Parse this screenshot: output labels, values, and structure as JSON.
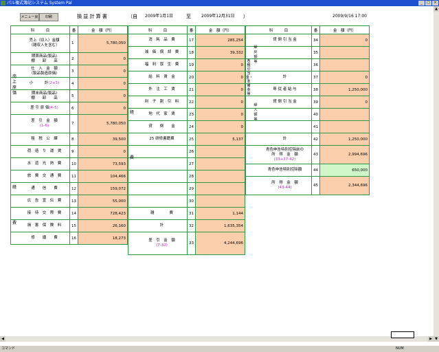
{
  "window": {
    "title": "パル複式簿記システム System Pal",
    "min": "_",
    "max": "□",
    "close": "×"
  },
  "toolbar": {
    "menu_back": "メニュー戻",
    "print": "印刷"
  },
  "header": {
    "report_title": "損 益 計 算 書",
    "from_label": "（自",
    "from_date": "2009年1月1日",
    "to_label": "至",
    "to_date": "2009年12月31日",
    "to_close": "）",
    "printed_at": "2009/9/16 17:00"
  },
  "col": {
    "item": "科　　　目",
    "no": "番",
    "amount": "金　額（円）"
  },
  "t1": {
    "rows": [
      {
        "no": "1",
        "label": "売上（収入）金額",
        "sub": "（雑収入を含む）",
        "amount": "5,780,050"
      },
      {
        "no": "2",
        "label": "期首商品(製品)",
        "sub": "棚　　卸　　高",
        "amount": "0"
      },
      {
        "no": "3",
        "label": "仕　入　金　額",
        "sub": "（製品製造原価）",
        "amount": "0"
      },
      {
        "no": "4",
        "label": "小　　　計",
        "pk": "(2+3)",
        "amount": "0"
      },
      {
        "no": "5",
        "label": "期末商品(製品)",
        "sub": "棚　　卸　　高",
        "amount": "0"
      },
      {
        "no": "6",
        "label": "差 引 原 価",
        "pk": "(4-5)",
        "amount": "0"
      },
      {
        "no": "7",
        "label": "差　引　金　額",
        "pksub": "(1-6)",
        "amount": "5,780,050"
      },
      {
        "no": "8",
        "label": "租　税　公　課",
        "amount": "39,500"
      },
      {
        "no": "9",
        "label": "荷　造　り　運　賃",
        "amount": "0"
      },
      {
        "no": "10",
        "label": "水　道　光　熱　費",
        "amount": "73,593"
      },
      {
        "no": "11",
        "label": "旅　費　交　通　費",
        "amount": "104,466"
      },
      {
        "no": "12",
        "label": "通　　信　　費",
        "amount": "159,072"
      },
      {
        "no": "13",
        "label": "広　告　宣　伝　費",
        "amount": "55,000"
      },
      {
        "no": "14",
        "label": "接　待　交　際　費",
        "amount": "728,423"
      },
      {
        "no": "15",
        "label": "損　害　保　険　料",
        "amount": "26,160"
      },
      {
        "no": "16",
        "label": "修　　繕　　費",
        "amount": "18,273"
      }
    ],
    "side_cost": "売上原価",
    "side_exp1": "経",
    "side_exp2": "費"
  },
  "t2": {
    "rows": [
      {
        "no": "17",
        "label": "消　耗　品　費",
        "amount": "285,254"
      },
      {
        "no": "18",
        "label": "減　価　償　却　費",
        "amount": "39,332"
      },
      {
        "no": "19",
        "label": "福　利　厚　生　費",
        "amount": "0"
      },
      {
        "no": "20",
        "label": "給　料　賃　金",
        "amount": "0"
      },
      {
        "no": "21",
        "label": "外　注　工　賃",
        "amount": "0"
      },
      {
        "no": "22",
        "label": "利　子　割　引　料",
        "amount": "0"
      },
      {
        "no": "23",
        "label": "地　代　家　賃",
        "amount": "0"
      },
      {
        "no": "24",
        "label": "貸　　倒　　金",
        "amount": "0"
      },
      {
        "no": "25",
        "label": "25 研修書籍費",
        "amount": "5,137"
      },
      {
        "no": "26",
        "label": "",
        "amount": ""
      },
      {
        "no": "27",
        "label": "",
        "amount": ""
      },
      {
        "no": "28",
        "label": "",
        "amount": ""
      },
      {
        "no": "29",
        "label": "",
        "amount": ""
      },
      {
        "no": "30",
        "label": "",
        "amount": ""
      },
      {
        "no": "31",
        "label": "雑　　　　費",
        "amount": "1,144"
      },
      {
        "no": "32",
        "label": "計",
        "amount": "1,635,354"
      },
      {
        "no": "33",
        "label": "差　引　金　額",
        "pksub": "(7-32)",
        "amount": "4,244,696"
      }
    ],
    "side_exp1": "経",
    "side_exp2": "費"
  },
  "t3": {
    "rows": [
      {
        "no": "34",
        "label": "貸 倒 引 当 金",
        "amount": "0"
      },
      {
        "no": "35",
        "label": "",
        "amount": ""
      },
      {
        "no": "36",
        "label": "",
        "amount": ""
      },
      {
        "no": "37",
        "label": "計",
        "amount": "0"
      },
      {
        "no": "38",
        "label": "専 従 者 給 与",
        "amount": "1,250,000"
      },
      {
        "no": "39",
        "label": "貸 倒 引 当 金",
        "amount": "0"
      },
      {
        "no": "40",
        "label": "",
        "amount": ""
      },
      {
        "no": "41",
        "label": "",
        "amount": ""
      },
      {
        "no": "42",
        "label": "計",
        "amount": "1,250,000"
      },
      {
        "no": "43",
        "label": "青色申告特別控除前の",
        "sub": "所　得　金　額",
        "pksub": "(33+37-42)",
        "amount": "2,994,696"
      },
      {
        "no": "44",
        "label": "青色申告特別控除額",
        "amount": "650,000"
      },
      {
        "no": "45",
        "label": "所　得　金　額",
        "pksub": "(43-44)",
        "amount": "2,344,696"
      }
    ],
    "side_outer": "各種引当金・準備金等",
    "side_kuri_mo": "繰戻額等",
    "side_kuri_ire": "繰入額等"
  },
  "status": {
    "left": "コマンド",
    "right": "NUM"
  }
}
